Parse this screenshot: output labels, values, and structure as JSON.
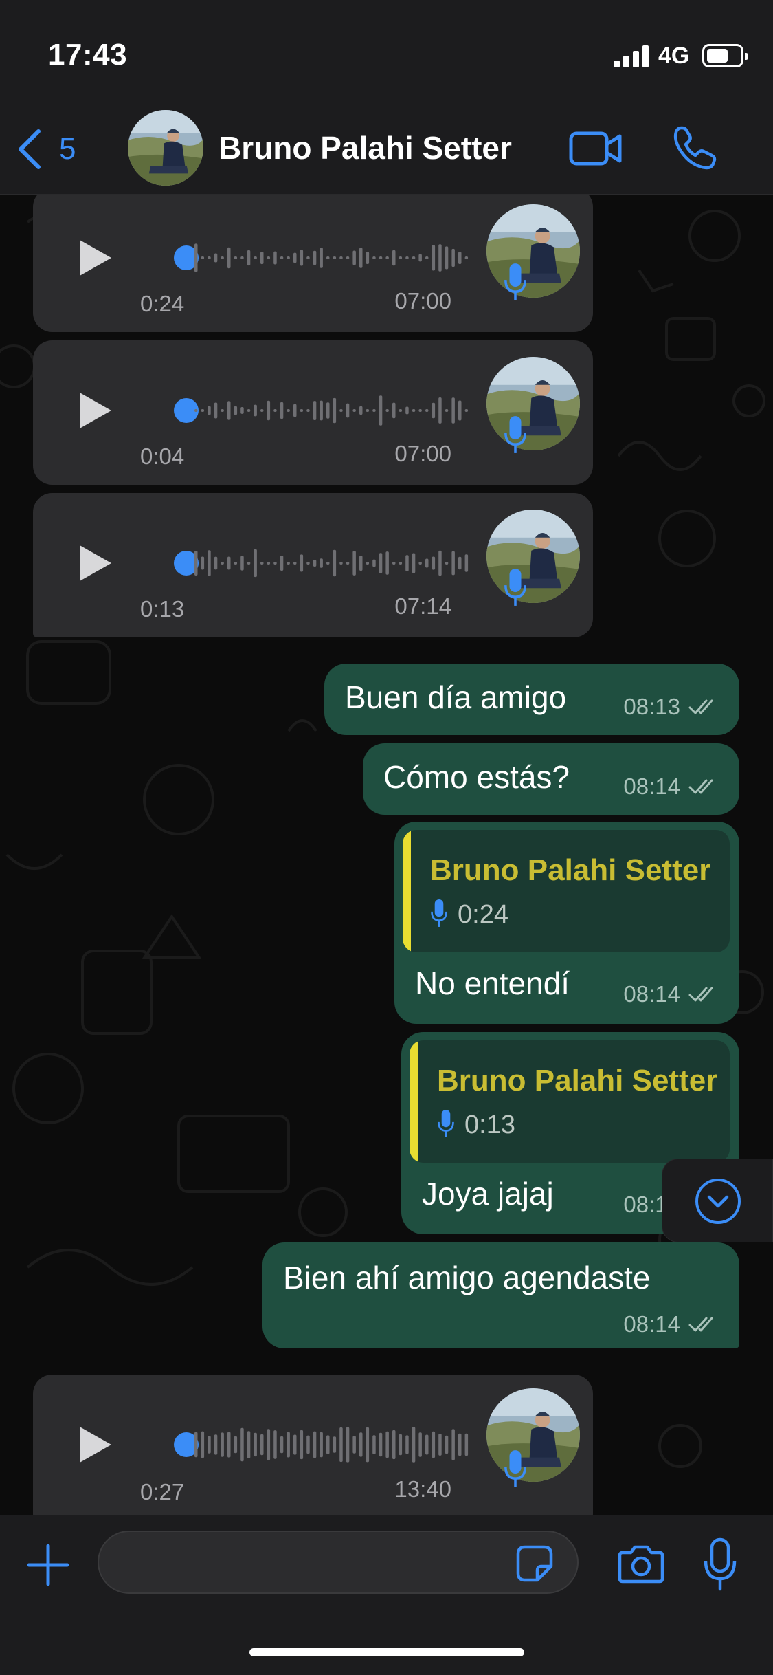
{
  "status_bar": {
    "time": "17:43",
    "network": "4G"
  },
  "header": {
    "back_count": "5",
    "contact_name": "Bruno Palahi Setter",
    "icons": [
      "chevron-left-icon",
      "video-camera-icon",
      "phone-icon"
    ]
  },
  "messages": {
    "voice_1": {
      "duration": "0:24",
      "time": "07:00"
    },
    "voice_2": {
      "duration": "0:04",
      "time": "07:00"
    },
    "voice_3": {
      "duration": "0:13",
      "time": "07:14"
    },
    "text_1": {
      "text": "Buen día amigo",
      "time": "08:13"
    },
    "text_2": {
      "text": "Cómo estás?",
      "time": "08:14"
    },
    "reply_1": {
      "quoted_name": "Bruno Palahi Setter",
      "quoted_duration": "0:24",
      "text": "No entendí",
      "time": "08:14"
    },
    "reply_2": {
      "quoted_name": "Bruno Palahi Setter",
      "quoted_duration": "0:13",
      "text": "Joya jajaj",
      "time": "08:14"
    },
    "text_3": {
      "text": "Bien ahí amigo agendaste",
      "time": "08:14"
    },
    "voice_4": {
      "duration": "0:27",
      "time": "13:40"
    }
  },
  "input": {
    "value": "",
    "placeholder": ""
  },
  "colors": {
    "accent": "#3b8df7",
    "outgoing_bubble": "#1f4f40",
    "incoming_bubble": "#2c2c2e",
    "quote_bar": "#e8dd31",
    "quote_name": "#c9bd33"
  }
}
